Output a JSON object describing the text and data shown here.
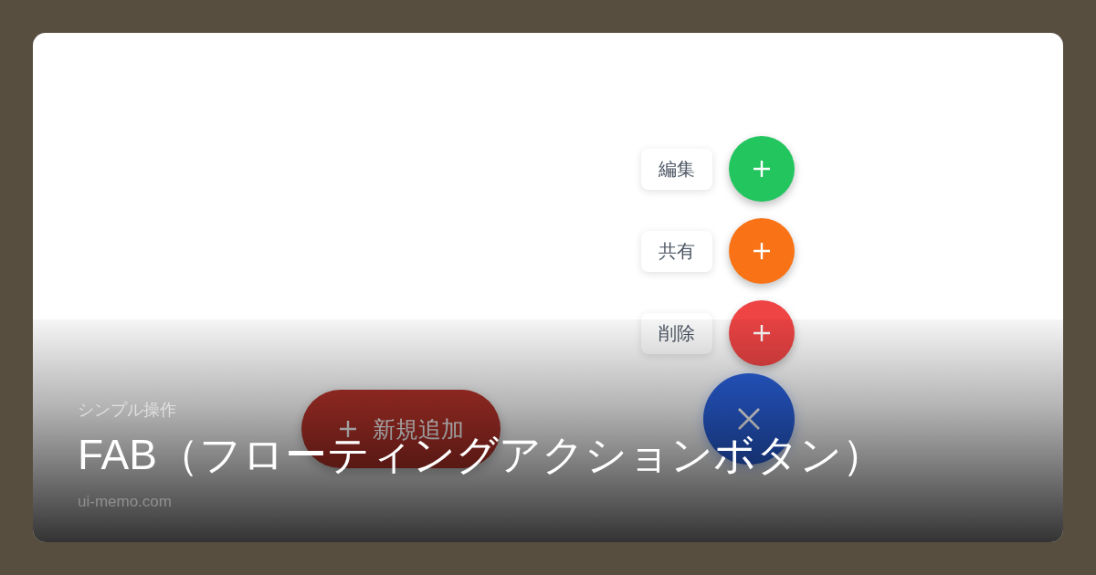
{
  "speed_dial": {
    "expanded": true,
    "actions": [
      {
        "label": "編集",
        "color": "#22c55e"
      },
      {
        "label": "共有",
        "color": "#f97316"
      },
      {
        "label": "削除",
        "color": "#ef4444"
      }
    ]
  },
  "extended_fab": {
    "label": "新規追加"
  },
  "caption": {
    "category": "シンプル操作",
    "title": "FAB（フローティングアクションボタン）",
    "site": "ui-memo.com"
  }
}
